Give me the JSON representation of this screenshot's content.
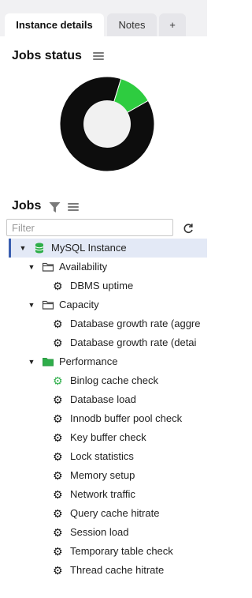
{
  "tabs": [
    {
      "label": "Instance details"
    },
    {
      "label": "Notes"
    },
    {
      "label": "+"
    }
  ],
  "jobs_status": {
    "title": "Jobs status",
    "chart_data": {
      "type": "pie",
      "slices": [
        {
          "value": 88,
          "color": "#0d0d0d"
        },
        {
          "value": 12,
          "color": "#2ecc40"
        }
      ]
    }
  },
  "jobs": {
    "title": "Jobs",
    "filter_placeholder": "Filter",
    "tree": {
      "root": {
        "label": "MySQL Instance",
        "icon": "database-icon"
      },
      "groups": [
        {
          "label": "Availability",
          "icon": "folder-icon",
          "items": [
            "DBMS uptime"
          ]
        },
        {
          "label": "Capacity",
          "icon": "folder-icon",
          "items": [
            "Database growth rate (aggre",
            "Database growth rate (detai"
          ]
        },
        {
          "label": "Performance",
          "icon": "folder-icon",
          "items": [
            "Binlog cache check",
            "Database load",
            "Innodb buffer pool check",
            "Key buffer check",
            "Lock statistics",
            "Memory setup",
            "Network traffic",
            "Query cache hitrate",
            "Session load",
            "Temporary table check",
            "Thread cache hitrate"
          ]
        }
      ]
    }
  }
}
